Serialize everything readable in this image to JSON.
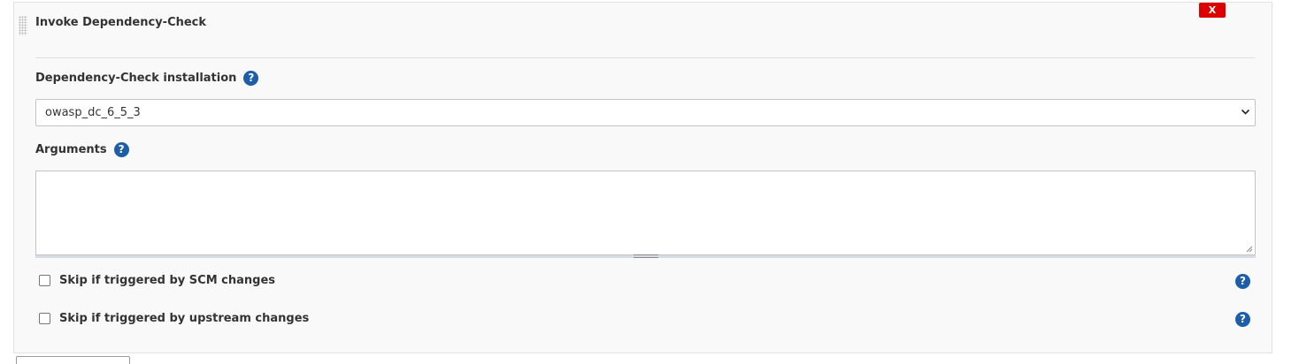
{
  "section": {
    "title": "Invoke Dependency-Check",
    "delete_label": "X"
  },
  "installation": {
    "label": "Dependency-Check installation",
    "selected_value": "owasp_dc_6_5_3"
  },
  "arguments": {
    "label": "Arguments",
    "value": ""
  },
  "options": [
    {
      "label": "Skip if triggered by SCM changes",
      "checked": false
    },
    {
      "label": "Skip if triggered by upstream changes",
      "checked": false
    }
  ],
  "help_glyph": "?",
  "colors": {
    "help_icon": "#1c5fa8",
    "delete_button": "#dd0000",
    "panel_bg": "#f9f9f9"
  }
}
